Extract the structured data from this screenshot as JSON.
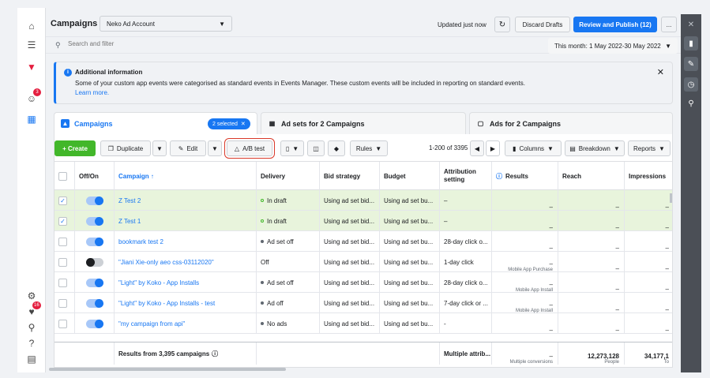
{
  "header": {
    "title": "Campaigns",
    "account": "Neko Ad Account",
    "updated": "Updated just now",
    "discard_label": "Discard Drafts",
    "publish_label": "Review and Publish (12)",
    "more_label": "..."
  },
  "search": {
    "placeholder": "Search and filter"
  },
  "date_range": "This month: 1 May 2022-30 May 2022",
  "info_banner": {
    "title": "Additional information",
    "body": "Some of your custom app events were categorised as standard events in Events Manager. These custom events will be included in reporting on standard events.",
    "link": "Learn more."
  },
  "tabs": {
    "campaigns": "Campaigns",
    "selected_pill": "2 selected",
    "ad_sets": "Ad sets for 2 Campaigns",
    "ads": "Ads for 2 Campaigns"
  },
  "toolbar": {
    "create": "+ Create",
    "duplicate": "Duplicate",
    "edit": "Edit",
    "abtest": "A/B test",
    "rules": "Rules",
    "pager": "1-200 of 3395",
    "columns": "Columns",
    "breakdown": "Breakdown",
    "reports": "Reports"
  },
  "columns": {
    "onoff": "Off/On",
    "campaign": "Campaign ↑",
    "delivery": "Delivery",
    "bid": "Bid strategy",
    "budget": "Budget",
    "attribution": "Attribution setting",
    "results": "Results",
    "reach": "Reach",
    "impressions": "Impressions"
  },
  "rows": [
    {
      "name": "Z Test 2",
      "delivery": "In draft",
      "bid": "Using ad set bid...",
      "budget": "Using ad set bu...",
      "attr": "–",
      "results": "–",
      "results_sub": "",
      "reach": "–",
      "impr": "–"
    },
    {
      "name": "Z Test 1",
      "delivery": "In draft",
      "bid": "Using ad set bid...",
      "budget": "Using ad set bu...",
      "attr": "–",
      "results": "–",
      "results_sub": "",
      "reach": "–",
      "impr": "–"
    },
    {
      "name": "bookmark test 2",
      "delivery": "Ad set off",
      "bid": "Using ad set bid...",
      "budget": "Using ad set bu...",
      "attr": "28-day click o...",
      "results": "–",
      "results_sub": "",
      "reach": "–",
      "impr": "–"
    },
    {
      "name": "\"Jiani Xie-only aeo css-03112020\"",
      "delivery": "Off",
      "bid": "Using ad set bid...",
      "budget": "Using ad set bu...",
      "attr": "1-day click",
      "results": "–",
      "results_sub": "Mobile App Purchase",
      "reach": "–",
      "impr": "–"
    },
    {
      "name": "\"Light\" by Koko - App Installs",
      "delivery": "Ad set off",
      "bid": "Using ad set bid...",
      "budget": "Using ad set bu...",
      "attr": "28-day click o...",
      "results": "–",
      "results_sub": "Mobile App Install",
      "reach": "–",
      "impr": "–"
    },
    {
      "name": "\"Light\" by Koko - App Installs - test",
      "delivery": "Ad off",
      "bid": "Using ad set bid...",
      "budget": "Using ad set bu...",
      "attr": "7-day click or ...",
      "results": "–",
      "results_sub": "Mobile App Install",
      "reach": "–",
      "impr": "–"
    },
    {
      "name": "\"my campaign from api\"",
      "delivery": "No ads",
      "bid": "Using ad set bid...",
      "budget": "Using ad set bu...",
      "attr": "-",
      "results": "–",
      "results_sub": "",
      "reach": "–",
      "impr": "–"
    }
  ],
  "footer": {
    "label": "Results from 3,395 campaigns",
    "attr": "Multiple attrib...",
    "results": "–",
    "results_sub": "Multiple conversions",
    "reach": "12,273,128",
    "reach_sub": "People",
    "impr": "34,177,1",
    "impr_sub": "To"
  },
  "nav_badges": {
    "notif": "3",
    "alerts": "16"
  }
}
